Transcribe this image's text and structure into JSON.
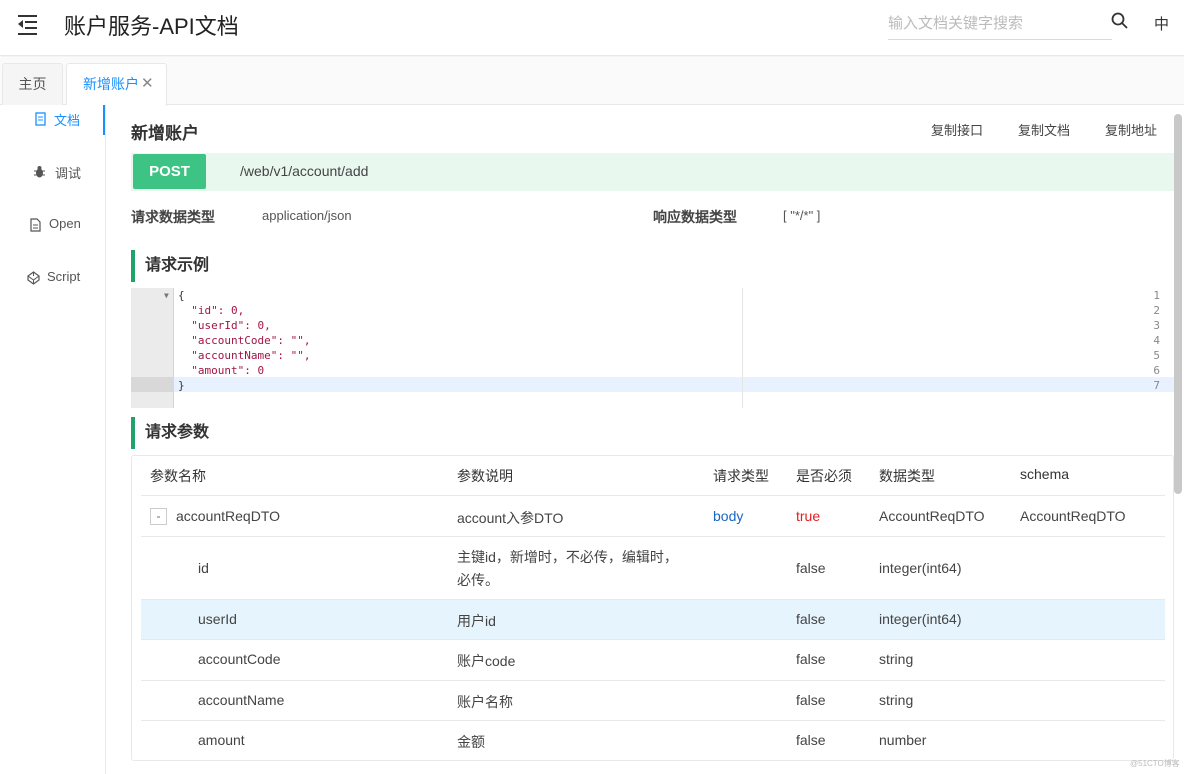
{
  "header": {
    "title": "账户服务-API文档",
    "search_placeholder": "输入文档关键字搜索",
    "lang": "中"
  },
  "tabs": [
    {
      "label": "主页",
      "active": false
    },
    {
      "label": "新增账户",
      "active": true
    }
  ],
  "sidenav": [
    {
      "label": "文档",
      "icon": "document-icon",
      "active": true
    },
    {
      "label": "调试",
      "icon": "bug-icon",
      "active": false
    },
    {
      "label": "Open",
      "icon": "file-icon",
      "active": false
    },
    {
      "label": "Script",
      "icon": "codepen-icon",
      "active": false
    }
  ],
  "doc": {
    "title": "新增账户",
    "actions": [
      "复制接口",
      "复制文档",
      "复制地址"
    ],
    "method": "POST",
    "path": "/web/v1/account/add",
    "request_type_label": "请求数据类型",
    "request_type": "application/json",
    "response_type_label": "响应数据类型",
    "response_type": "[ \"*/*\" ]",
    "example_title": "请求示例",
    "params_title": "请求参数"
  },
  "example": {
    "line_numbers": [
      "1",
      "2",
      "3",
      "4",
      "5",
      "6",
      "7"
    ],
    "lines": [
      "{",
      "  \"id\": 0,",
      "  \"userId\": 0,",
      "  \"accountCode\": \"\",",
      "  \"accountName\": \"\",",
      "  \"amount\": 0",
      "}"
    ]
  },
  "params_table": {
    "columns": [
      "参数名称",
      "参数说明",
      "请求类型",
      "是否必须",
      "数据类型",
      "schema"
    ],
    "rows": [
      {
        "expand": "-",
        "name": "accountReqDTO",
        "desc": "account入参DTO",
        "in": "body",
        "required": "true",
        "type": "AccountReqDTO",
        "schema": "AccountReqDTO"
      },
      {
        "name": "id",
        "desc_line1": "主键id，新增时，不必传，编辑时，",
        "desc_line2": "必传。",
        "required": "false",
        "type": "integer(int64)"
      },
      {
        "name": "userId",
        "desc": "用户id",
        "required": "false",
        "type": "integer(int64)",
        "highlighted": true
      },
      {
        "name": "accountCode",
        "desc": "账户code",
        "required": "false",
        "type": "string"
      },
      {
        "name": "accountName",
        "desc": "账户名称",
        "required": "false",
        "type": "string"
      },
      {
        "name": "amount",
        "desc": "金额",
        "required": "false",
        "type": "number"
      }
    ]
  },
  "watermark": "@51CTO博客",
  "colors": {
    "accent": "#1890ff",
    "post": "#3dc383",
    "endpoint_bg": "#e8f8ef",
    "section_bar": "#20a36a",
    "body_type": "#1866c2",
    "required_true": "#e02020"
  }
}
